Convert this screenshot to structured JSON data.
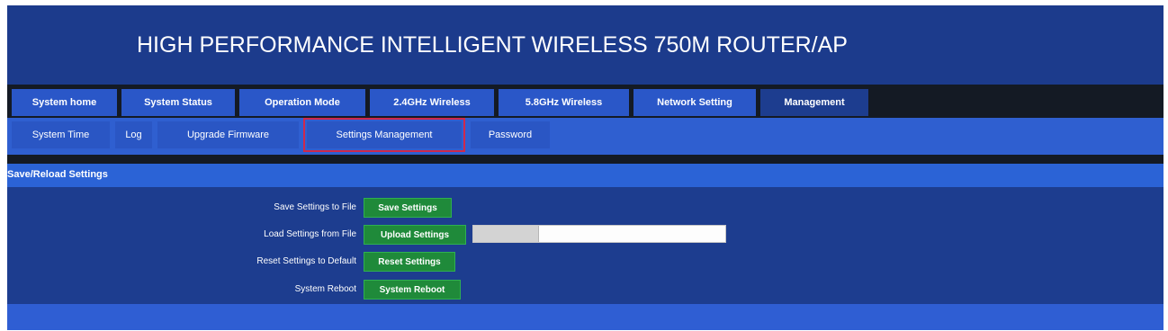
{
  "header": {
    "title": "HIGH PERFORMANCE INTELLIGENT WIRELESS 750M ROUTER/AP"
  },
  "main_tabs": [
    {
      "label": "System home"
    },
    {
      "label": "System Status"
    },
    {
      "label": "Operation Mode"
    },
    {
      "label": "2.4GHz Wireless"
    },
    {
      "label": "5.8GHz Wireless"
    },
    {
      "label": "Network Setting"
    },
    {
      "label": "Management",
      "active": true
    }
  ],
  "sub_tabs": [
    {
      "label": "System Time"
    },
    {
      "label": "Log"
    },
    {
      "label": "Upgrade Firmware"
    },
    {
      "label": "Settings Management",
      "highlighted": true
    },
    {
      "label": "Password"
    }
  ],
  "section": {
    "title": "Save/Reload Settings"
  },
  "rows": [
    {
      "label": "Save Settings to File",
      "button": "Save Settings"
    },
    {
      "label": "Load Settings from File",
      "button": "Upload Settings"
    },
    {
      "label": "Reset Settings to Default",
      "button": "Reset Settings"
    },
    {
      "label": "System Reboot",
      "button": "System Reboot"
    }
  ],
  "colors": {
    "header_bg": "#1c3b8c",
    "tab_bg": "#2a57c8",
    "highlight_outline": "#d0294c",
    "action_button": "#1f8a3a"
  }
}
